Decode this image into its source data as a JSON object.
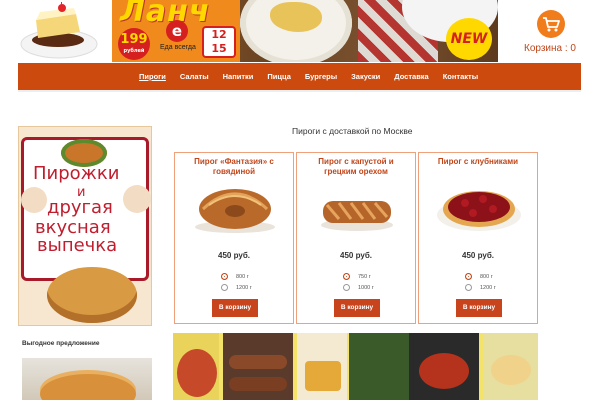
{
  "header": {
    "banner": {
      "word": "Ланч",
      "price_value": "199",
      "price_unit": "рублей",
      "always_text": "Еда всегда",
      "time_from": "12",
      "time_to": "15",
      "new_badge": "NEW"
    },
    "cart_label": "Корзина : 0",
    "colors": {
      "accent": "#cc4a0e",
      "cart": "#f07c1c",
      "text_accent": "#c0461a"
    }
  },
  "nav": {
    "items": [
      "Пироги",
      "Салаты",
      "Напитки",
      "Пицца",
      "Бургеры",
      "Закуски",
      "Доставка",
      "Контакты"
    ],
    "active": "Пироги"
  },
  "sidebar": {
    "book": {
      "line1": "Пирожки",
      "line2": "и",
      "line3": "другая",
      "line4": "вкусная",
      "line5": "выпечка"
    },
    "offer_title": "Выгодное предложение"
  },
  "main": {
    "section_title": "Пироги с доставкой по Москве",
    "products": [
      {
        "name": "Пирог «Фантазия» с говядиной",
        "price": "450 руб.",
        "options": [
          "800 г",
          "1200 г"
        ],
        "selected": 0,
        "button": "В корзину"
      },
      {
        "name": "Пирог с капустой и грецким орехом",
        "price": "450 руб.",
        "options": [
          "750 г",
          "1000 г"
        ],
        "selected": 0,
        "button": "В корзину"
      },
      {
        "name": "Пирог с клубниками",
        "price": "450 руб.",
        "options": [
          "800 г",
          "1200 г"
        ],
        "selected": 0,
        "button": "В корзину"
      }
    ]
  }
}
